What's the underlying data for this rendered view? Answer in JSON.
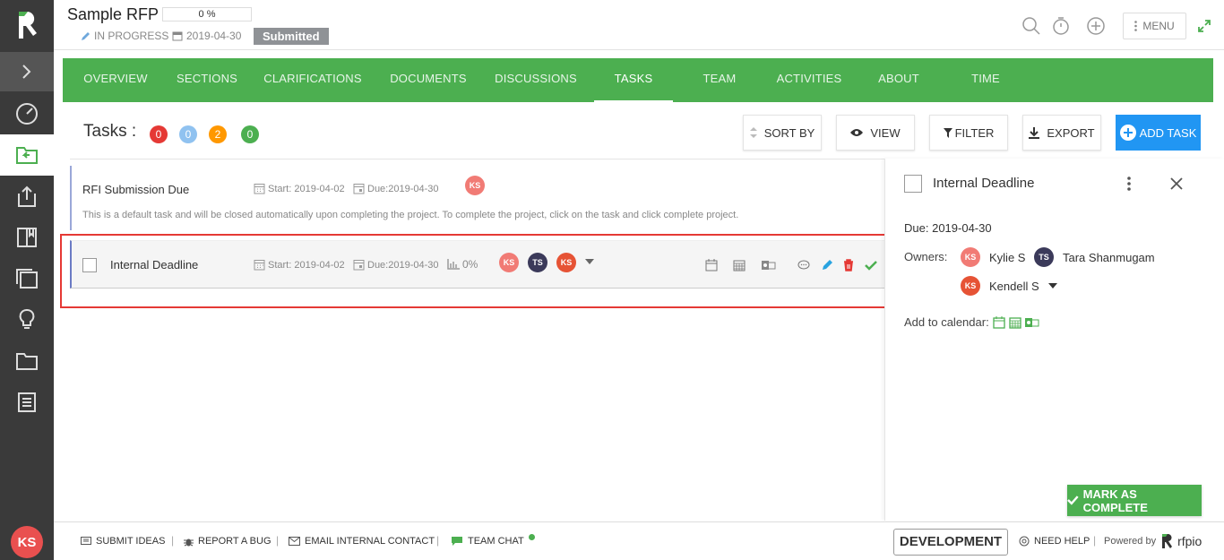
{
  "project": {
    "title": "Sample RFP",
    "progress": "0 %",
    "status": "IN PROGRESS",
    "date": "2019-04-30",
    "badge": "Submitted"
  },
  "topbar": {
    "menu_label": "MENU"
  },
  "nav": {
    "tabs": [
      "OVERVIEW",
      "SECTIONS",
      "CLARIFICATIONS",
      "DOCUMENTS",
      "DISCUSSIONS",
      "TASKS",
      "TEAM",
      "ACTIVITIES",
      "ABOUT",
      "TIME"
    ],
    "active": "TASKS"
  },
  "tasks_header": {
    "label": "Tasks :",
    "counts": [
      "0",
      "0",
      "2",
      "0"
    ],
    "count_colors": [
      "#e53935",
      "#90c2f0",
      "#ff9800",
      "#4caf50"
    ],
    "sort_label": "SORT BY",
    "view_label": "VIEW",
    "filter_label": "FILTER",
    "export_label": "EXPORT",
    "add_label": "ADD TASK"
  },
  "tasks": [
    {
      "name": "RFI Submission Due",
      "start": "Start: 2019-04-02",
      "due": "Due:2019-04-30",
      "owners": [
        "KS"
      ],
      "description": "This is a default task and will be closed automatically upon completing the project. To complete the project, click on the task and click complete project."
    },
    {
      "name": "Internal Deadline",
      "start": "Start: 2019-04-02",
      "due": "Due:2019-04-30",
      "progress": "0%",
      "owners": [
        "KS",
        "TS",
        "KS"
      ]
    }
  ],
  "panel": {
    "title": "Internal Deadline",
    "due_label": "Due:",
    "due_value": "2019-04-30",
    "owners_label": "Owners:",
    "owners": [
      {
        "initials": "KS",
        "name": "Kylie S"
      },
      {
        "initials": "TS",
        "name": "Tara Shanmugam"
      },
      {
        "initials": "KS",
        "name": "Kendell S"
      }
    ],
    "calendar_label": "Add to calendar:",
    "complete_label": "MARK AS COMPLETE"
  },
  "footer": {
    "submit_ideas": "SUBMIT IDEAS",
    "report_bug": "REPORT A BUG",
    "email_contact": "EMAIL INTERNAL CONTACT",
    "team_chat": "TEAM CHAT",
    "environment": "DEVELOPMENT",
    "need_help": "NEED HELP",
    "powered_by": "Powered by",
    "brand": "rfpio"
  },
  "user": {
    "initials": "KS"
  },
  "colors": {
    "accent": "#4caf50",
    "primary": "#2196f3",
    "danger": "#e53935",
    "sidebar": "#3a3a3a"
  }
}
